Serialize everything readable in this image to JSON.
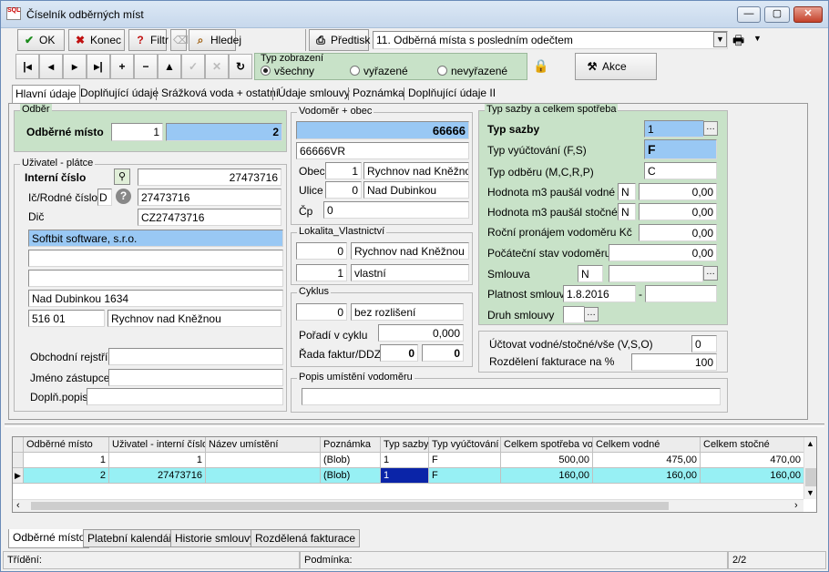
{
  "window": {
    "title": "Číselník odběrných míst",
    "icon_text": "SQL"
  },
  "toolbar": {
    "ok": "OK",
    "konec": "Konec",
    "filtr": "Filtr",
    "hledej": "Hledej",
    "predtisk": "Předtisk",
    "report_select": "11. Odběrná místa s posledním odečtem",
    "akce": "Akce"
  },
  "typ_zobrazeni": {
    "label": "Typ zobrazení",
    "options": [
      "všechny",
      "vyřazené",
      "nevyřazené"
    ],
    "selected": "všechny"
  },
  "tabs": [
    "Hlavní údaje",
    "Doplňující údaje",
    "Srážková voda + ostatní",
    "Údaje smlouvy",
    "Poznámka",
    "Doplňující údaje II"
  ],
  "odber": {
    "group": "Odběr",
    "label": "Odběrné místo",
    "value1": "1",
    "value2": "2"
  },
  "uzivatel": {
    "group": "Uživatel - plátce",
    "interni_label": "Interní číslo",
    "interni_value": "27473716",
    "ic_label": "Ič/Rodné číslo",
    "ic_flag": "D",
    "ic_value": "27473716",
    "dic_label": "Dič",
    "dic_value": "CZ27473716",
    "name": "Softbit software, s.r.o.",
    "line2": "",
    "line3": "",
    "street": "Nad Dubinkou 1634",
    "psc": "516 01",
    "city": "Rychnov nad Kněžnou",
    "obch_label": "Obchodní rejstřík",
    "zast_label": "Jméno zástupce",
    "popis_label": "Doplň.popis"
  },
  "vodomer": {
    "group": "Vodoměr + obec",
    "number": "66666",
    "code": "66666VR",
    "obec_label": "Obec",
    "obec_num": "1",
    "obec_name": "Rychnov nad Kněžnou",
    "ulice_label": "Ulice",
    "ulice_num": "0",
    "ulice_name": "Nad Dubinkou",
    "cp_label": "Čp",
    "cp_value": "0"
  },
  "lokalita": {
    "group": "Lokalita_Vlastnictví",
    "num1": "0",
    "name1": "Rychnov nad Kněžnou",
    "num2": "1",
    "name2": "vlastní"
  },
  "cyklus": {
    "group": "Cyklus",
    "num": "0",
    "name": "bez rozlišení",
    "poradi_label": "Pořadí v cyklu",
    "poradi_value": "0,000",
    "rada_label": "Řada faktur/DDZ",
    "rada1": "0",
    "rada2": "0"
  },
  "popis_umisteni": {
    "group": "Popis umístění vodoměru"
  },
  "sazba": {
    "group": "Typ sazby a celkem spotřeba",
    "typ_sazby_label": "Typ sazby",
    "typ_sazby_value": "1",
    "typ_vyuct_label": "Typ vyúčtování (F,S)",
    "typ_vyuct_value": "F",
    "typ_odberu_label": "Typ odběru (M,C,R,P)",
    "typ_odberu_value": "C",
    "pausal_vodne_label": "Hodnota m3 paušál vodné",
    "pausal_vodne_flag": "N",
    "pausal_vodne_value": "0,00",
    "pausal_stocne_label": "Hodnota m3 paušál stočné",
    "pausal_stocne_flag": "N",
    "pausal_stocne_value": "0,00",
    "pronajem_label": "Roční pronájem vodoměru Kč",
    "pronajem_value": "0,00",
    "poc_stav_label": "Počáteční stav vodoměru",
    "poc_stav_value": "0,00",
    "smlouva_label": "Smlouva",
    "smlouva_flag": "N",
    "platnost_label": "Platnost smlouvy",
    "platnost_value": "1.8.2016",
    "platnost_sep": "-",
    "druh_label": "Druh smlouvy"
  },
  "uctovat": {
    "label": "Účtovat vodné/stočné/vše (V,S,O)",
    "value": "0",
    "rozdeleni_label": "Rozdělení fakturace na %",
    "rozdeleni_value": "100"
  },
  "grid": {
    "columns": [
      "Odběrné místo",
      "Uživatel - interní číslo",
      "Název umístění",
      "Poznámka",
      "Typ sazby",
      "Typ vyúčtování",
      "Celkem spotřeba vo",
      "Celkem vodné",
      "Celkem stočné"
    ],
    "rows": [
      [
        "1",
        "1",
        "",
        "(Blob)",
        "1",
        "F",
        "500,00",
        "475,00",
        "470,00"
      ],
      [
        "2",
        "27473716",
        "",
        "(Blob)",
        "1",
        "F",
        "160,00",
        "160,00",
        "160,00"
      ]
    ]
  },
  "bottom_tabs": [
    "Odběrné místo",
    "Platební kalendář",
    "Historie smlouvy",
    "Rozdělená fakturace"
  ],
  "status": {
    "trideni": "Třídění:",
    "podminka": "Podmínka:",
    "count": "2/2"
  },
  "colors": {
    "accent_blue": "#99c8f4",
    "panel_green": "#c8e2c8",
    "selection_cyan": "#97f0f4"
  }
}
